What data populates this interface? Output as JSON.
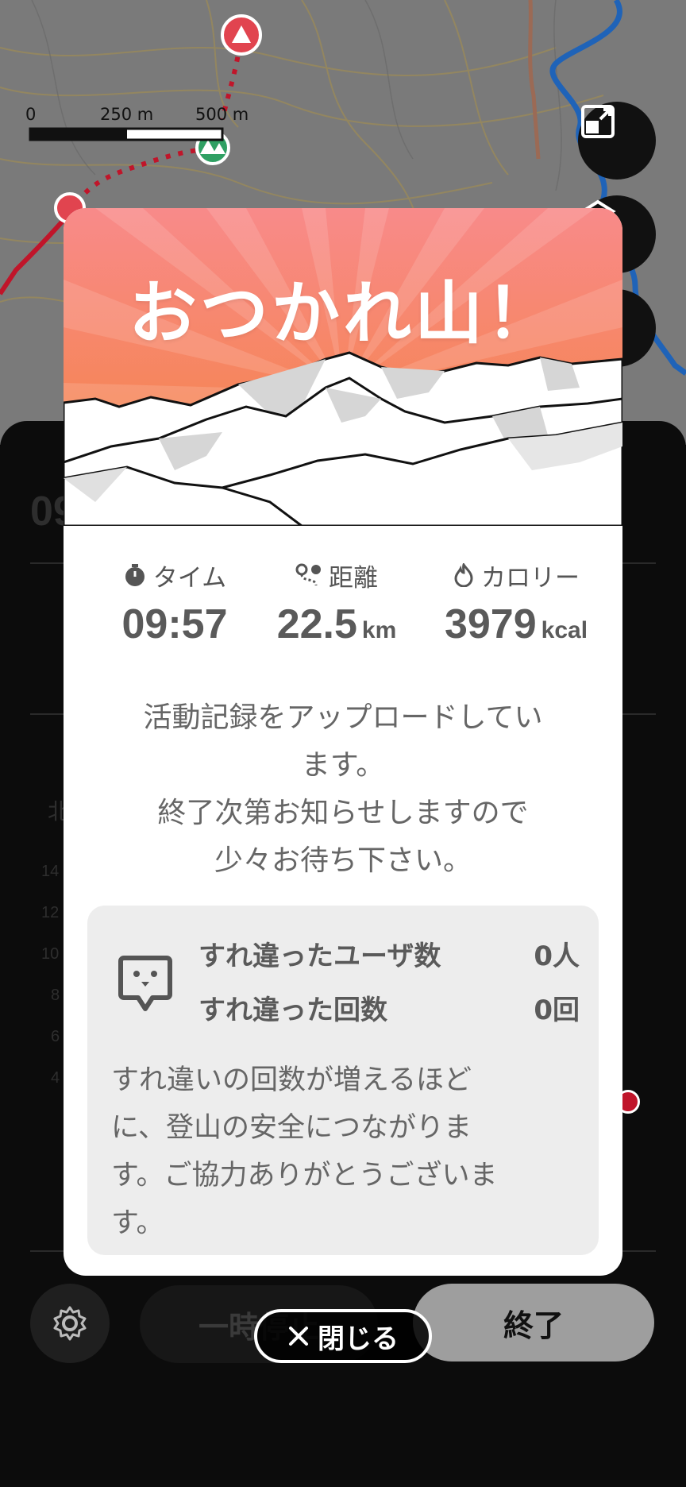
{
  "map": {
    "scale_labels": [
      "0",
      "250 m",
      "500 m"
    ]
  },
  "background_sheet": {
    "time_partial": "09",
    "compass_partial": "北",
    "elevation_ticks": [
      "14",
      "12",
      "10",
      "8",
      "6",
      "4"
    ],
    "pause_label": "一時停止",
    "end_label": "終了"
  },
  "modal": {
    "title": "おつかれ山！",
    "stats": [
      {
        "icon": "stopwatch-icon",
        "label": "タイム",
        "value": "09:57",
        "unit": ""
      },
      {
        "icon": "route-icon",
        "label": "距離",
        "value": "22.5",
        "unit": "km"
      },
      {
        "icon": "flame-icon",
        "label": "カロリー",
        "value": "3979",
        "unit": "kcal"
      }
    ],
    "message_lines": [
      "活動記録をアップロードしてい",
      "ます。",
      "終了次第お知らせしますので",
      "少々お待ち下さい。"
    ],
    "passing": {
      "users_label": "すれ違ったユーザ数",
      "users_value": "0人",
      "count_label": "すれ違った回数",
      "count_value": "0回",
      "note_lines": [
        "すれ違いの回数が増えるほど",
        "に、登山の安全につながりま",
        "す。ご協力ありがとうございま",
        "す。"
      ]
    },
    "close_label": "閉じる"
  },
  "colors": {
    "hero_top": "#f88a8a",
    "hero_bottom": "#f5833b",
    "route_red": "#c0152a",
    "river_blue": "#1f63b8"
  }
}
